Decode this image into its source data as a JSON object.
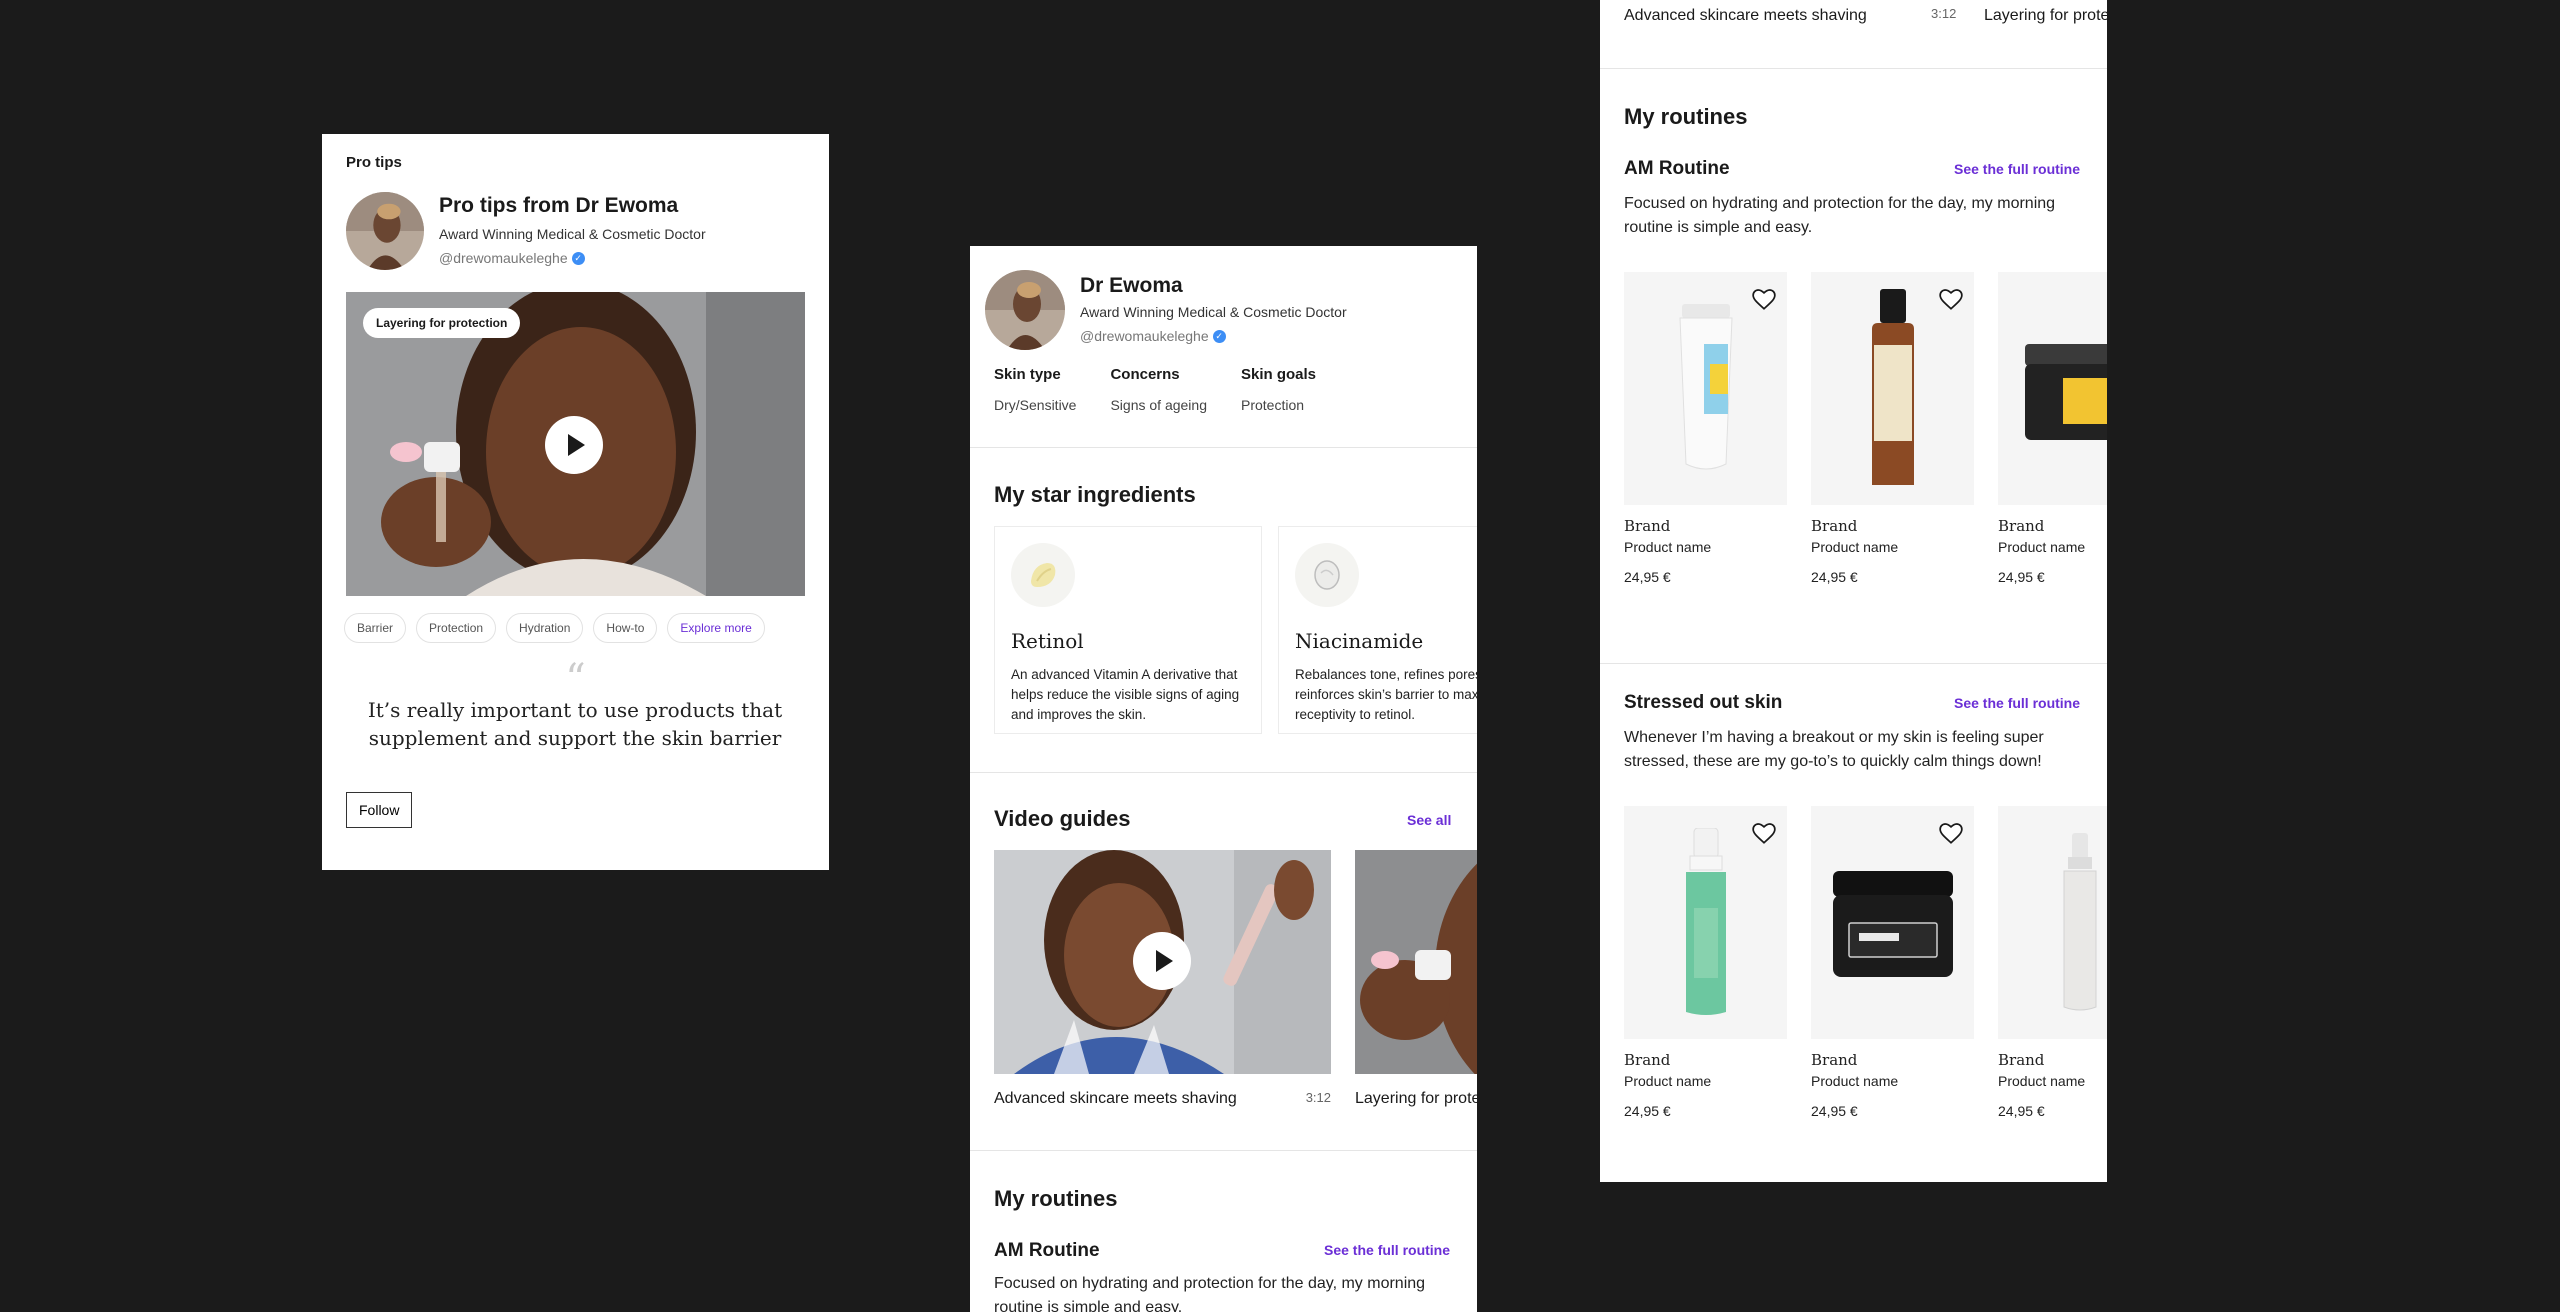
{
  "card1": {
    "section_label": "Pro tips",
    "title": "Pro tips from Dr Ewoma",
    "role": "Award Winning Medical & Cosmetic Doctor",
    "handle": "@drewomaukeleghe",
    "hero_badge": "Layering for protection",
    "tags": [
      "Barrier",
      "Protection",
      "Hydration",
      "How-to"
    ],
    "explore_label": "Explore more",
    "quote": "It’s really important to use products that supplement and support the skin barrier",
    "follow_label": "Follow"
  },
  "profile": {
    "name": "Dr Ewoma",
    "role": "Award Winning Medical & Cosmetic Doctor",
    "handle": "@drewomaukeleghe",
    "attributes": [
      {
        "key": "Skin type",
        "value": "Dry/Sensitive"
      },
      {
        "key": "Concerns",
        "value": "Signs of ageing"
      },
      {
        "key": "Skin goals",
        "value": "Protection"
      }
    ]
  },
  "ingredients": {
    "heading": "My star ingredients",
    "items": [
      {
        "name": "Retinol",
        "desc": "An advanced Vitamin A derivative that helps reduce the visible signs of aging and improves the skin."
      },
      {
        "name": "Niacinamide",
        "desc": "Rebalances tone, refines pores and reinforces skin’s barrier to maximize receptivity to retinol."
      }
    ]
  },
  "videos": {
    "heading": "Video guides",
    "see_all": "See all",
    "items": [
      {
        "title": "Advanced skincare meets shaving",
        "duration": "3:12"
      },
      {
        "title": "Layering for protection",
        "duration": ""
      }
    ]
  },
  "routines": {
    "heading": "My routines",
    "see_full": "See the full routine",
    "list": [
      {
        "name": "AM Routine",
        "desc": "Focused on hydrating and protection for the day, my morning routine is simple and easy.",
        "products": [
          {
            "brand": "Brand",
            "name": "Product name",
            "price": "24,95 €"
          },
          {
            "brand": "Brand",
            "name": "Product name",
            "price": "24,95 €"
          },
          {
            "brand": "Brand",
            "name": "Product name",
            "price": "24,95 €"
          }
        ]
      },
      {
        "name": "Stressed out skin",
        "desc": "Whenever I’m having a breakout or my skin is feeling super stressed, these are my go-to’s to quickly calm things down!",
        "products": [
          {
            "brand": "Brand",
            "name": "Product name",
            "price": "24,95 €"
          },
          {
            "brand": "Brand",
            "name": "Product name",
            "price": "24,95 €"
          },
          {
            "brand": "Brand",
            "name": "Product name",
            "price": "24,95 €"
          }
        ]
      }
    ]
  },
  "colors": {
    "accent": "#6b2fd6",
    "verified": "#3d8ef5",
    "background": "#1b1b1b"
  }
}
